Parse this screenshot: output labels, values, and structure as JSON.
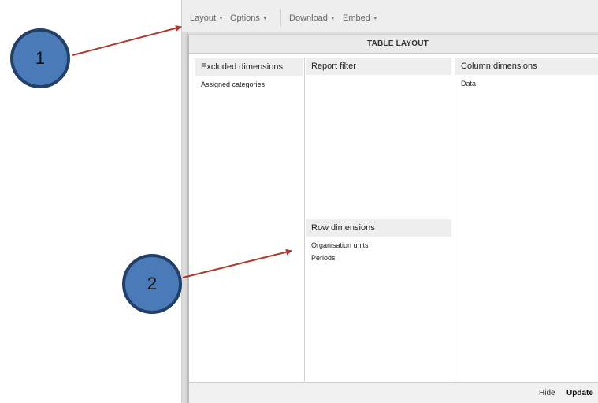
{
  "toolbar": {
    "menus": [
      {
        "label": "Layout"
      },
      {
        "label": "Options"
      },
      {
        "label": "Download"
      },
      {
        "label": "Embed"
      }
    ]
  },
  "dialog": {
    "title": "TABLE LAYOUT",
    "close_symbol": "×",
    "excluded": {
      "title": "Excluded dimensions",
      "items": [
        "Assigned categories"
      ]
    },
    "report_filter": {
      "title": "Report filter",
      "items": []
    },
    "column_dims": {
      "title": "Column dimensions",
      "items": [
        "Data"
      ]
    },
    "row_dims": {
      "title": "Row dimensions",
      "items": [
        "Organisation units",
        "Periods"
      ]
    },
    "footer": {
      "hide_label": "Hide",
      "update_label": "Update"
    }
  },
  "callouts": [
    {
      "label": "1"
    },
    {
      "label": "2"
    }
  ],
  "colors": {
    "callout_fill": "#4a7ab7",
    "callout_border": "#23406a",
    "arrow": "#b03a2e"
  }
}
